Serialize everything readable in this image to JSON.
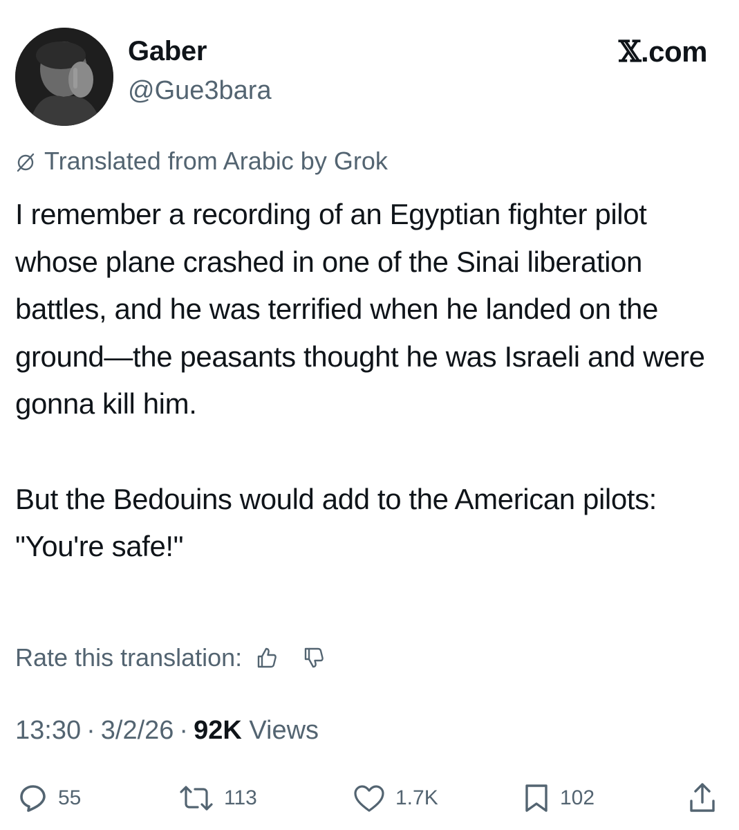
{
  "author": {
    "display_name": "Gaber",
    "handle": "@Gue3bara",
    "avatar_icon": "profile-photo"
  },
  "brand": {
    "glyph": "𝕏",
    "suffix": ".com"
  },
  "translation": {
    "icon": "globe-icon",
    "label": "Translated from Arabic by Grok"
  },
  "tweet": {
    "paragraph_1": "I remember a recording of an Egyptian fighter pilot whose plane crashed in one of the Sinai liberation battles, and he was terrified when he landed on the ground—the peasants thought he was Israeli and were gonna kill him.",
    "paragraph_2": "But the Bedouins would add to the American pilots: \"You're safe!\""
  },
  "rate": {
    "label": "Rate this translation:",
    "thumbs_up_icon": "thumbs-up-icon",
    "thumbs_down_icon": "thumbs-down-icon"
  },
  "meta": {
    "time": "13:30",
    "date": "3/2/26",
    "separator": "·",
    "views_count": "92K",
    "views_label": "Views"
  },
  "actions": {
    "replies": "55",
    "reposts": "113",
    "likes": "1.7K",
    "bookmarks": "102"
  },
  "colors": {
    "text_primary": "#0f1419",
    "text_secondary": "#536471",
    "background": "#ffffff"
  }
}
